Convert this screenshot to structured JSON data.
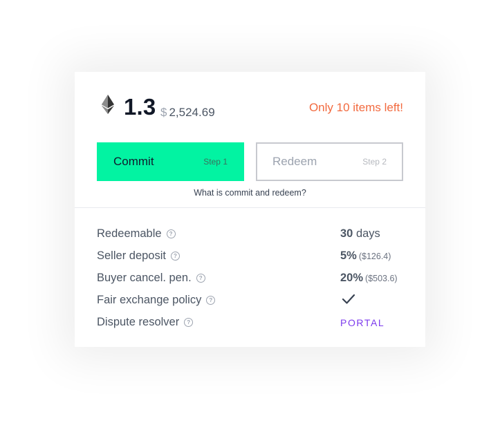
{
  "price": {
    "amount": "1.3",
    "usd_symbol": "$",
    "usd_value": "2,524.69",
    "currency_icon": "ethereum-icon"
  },
  "stock_notice": "Only 10 items left!",
  "actions": {
    "commit": {
      "label": "Commit",
      "step": "Step 1"
    },
    "redeem": {
      "label": "Redeem",
      "step": "Step 2"
    },
    "help_link": "What is commit and redeem?"
  },
  "details": [
    {
      "label": "Redeemable",
      "value": "30",
      "unit": " days",
      "extra": ""
    },
    {
      "label": "Seller deposit",
      "value": "5%",
      "unit": "",
      "extra": "($126.4)"
    },
    {
      "label": "Buyer cancel. pen.",
      "value": "20%",
      "unit": "",
      "extra": "($503.6)"
    },
    {
      "label": "Fair exchange policy",
      "value_icon": "checkmark-icon"
    },
    {
      "label": "Dispute resolver",
      "value": "PORTAL"
    }
  ],
  "colors": {
    "commit_bg": "#02f3a2",
    "stock_notice": "#f26a3f",
    "portal": "#7c3aed"
  }
}
